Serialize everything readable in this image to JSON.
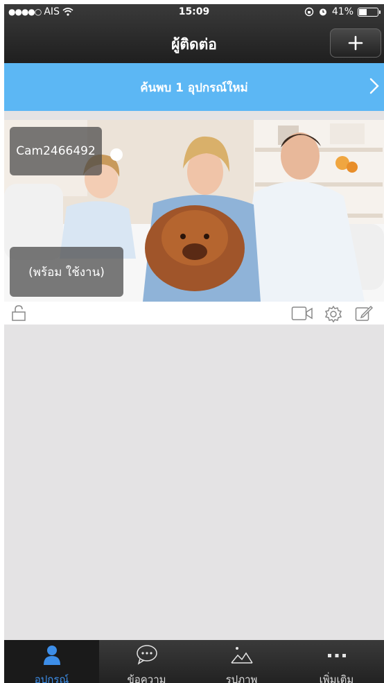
{
  "status_bar": {
    "carrier": "AIS",
    "time": "15:09",
    "battery": "41%",
    "battery_level": 0.41
  },
  "nav": {
    "title": "ผู้ติดต่อ"
  },
  "banner": {
    "text": "ค้นพบ 1 อุปกรณ์ใหม่"
  },
  "camera": {
    "name": "Cam2466492",
    "status": "(พร้อม ใช้งาน)"
  },
  "tabs": [
    {
      "label": "อุปกรณ์",
      "icon": "person-icon",
      "active": true
    },
    {
      "label": "ข้อความ",
      "icon": "chat-bubble-icon",
      "active": false
    },
    {
      "label": "รูปภาพ",
      "icon": "image-icon",
      "active": false
    },
    {
      "label": "เพิ่มเติม",
      "icon": "more-icon",
      "active": false
    }
  ],
  "colors": {
    "banner": "#5cb7f4",
    "active_tab": "#3d8ee8",
    "background": "#e4e3e4"
  }
}
